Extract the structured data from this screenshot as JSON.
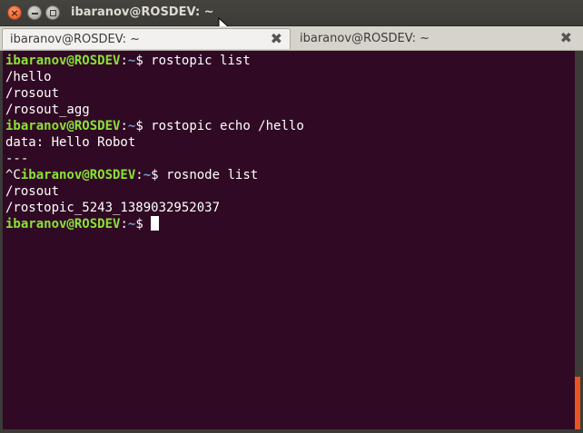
{
  "window": {
    "title": "ibaranov@ROSDEV: ~",
    "close_symbol": "×",
    "buttons": [
      "close-icon",
      "minimize-icon",
      "maximize-icon"
    ]
  },
  "tabs": [
    {
      "label": "ibaranov@ROSDEV: ~",
      "active": true,
      "close_symbol": "✖"
    },
    {
      "label": "ibaranov@ROSDEV: ~",
      "active": false,
      "close_symbol": "✖"
    }
  ],
  "terminal": {
    "lines": [
      {
        "user": "ibaranov@ROSDEV",
        "sep": ":",
        "path": "~",
        "rest": "$ rostopic list"
      },
      {
        "text": "/hello"
      },
      {
        "text": "/rosout"
      },
      {
        "text": "/rosout_agg"
      },
      {
        "user": "ibaranov@ROSDEV",
        "sep": ":",
        "path": "~",
        "rest": "$ rostopic echo /hello"
      },
      {
        "text": "data: Hello Robot"
      },
      {
        "text": "---"
      },
      {
        "prefix": "^C",
        "user": "ibaranov@ROSDEV",
        "sep": ":",
        "path": "~",
        "rest": "$ rosnode list"
      },
      {
        "text": "/rosout"
      },
      {
        "text": "/rostopic_5243_1389032952037"
      },
      {
        "user": "ibaranov@ROSDEV",
        "sep": ":",
        "path": "~",
        "rest": "$ ",
        "cursor": true
      }
    ]
  },
  "colors": {
    "terminal_bg": "#300a24",
    "prompt_user": "#8ae234",
    "prompt_path": "#729fcf",
    "scroll_thumb": "#e95420"
  }
}
